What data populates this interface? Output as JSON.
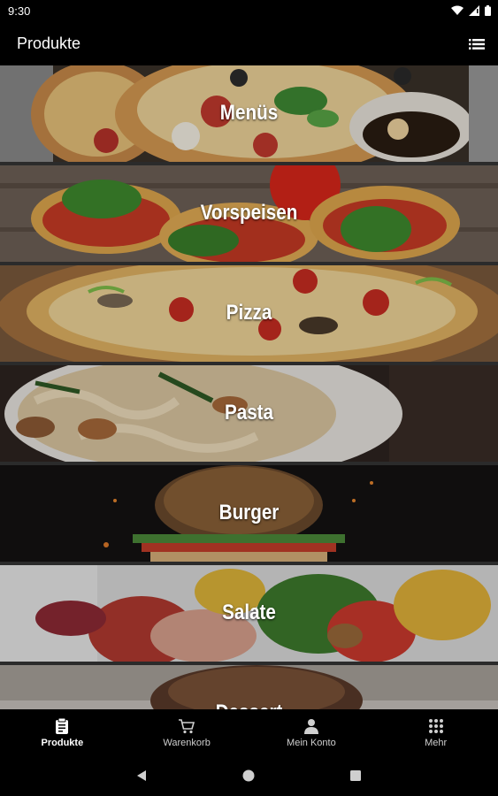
{
  "status_bar": {
    "time": "9:30"
  },
  "app_bar": {
    "title": "Produkte",
    "list_icon": "list-view-icon"
  },
  "categories": [
    {
      "label": "Menüs",
      "image": "menu-food-photo"
    },
    {
      "label": "Vorspeisen",
      "image": "bruschetta-photo"
    },
    {
      "label": "Pizza",
      "image": "pizza-photo"
    },
    {
      "label": "Pasta",
      "image": "pasta-photo"
    },
    {
      "label": "Burger",
      "image": "burger-photo"
    },
    {
      "label": "Salate",
      "image": "salad-photo"
    },
    {
      "label": "Dessert",
      "image": "dessert-photo"
    }
  ],
  "bottom_nav": [
    {
      "label": "Produkte",
      "icon": "clipboard-icon",
      "active": true
    },
    {
      "label": "Warenkorb",
      "icon": "cart-icon",
      "active": false
    },
    {
      "label": "Mein Konto",
      "icon": "person-icon",
      "active": false
    },
    {
      "label": "Mehr",
      "icon": "grid-icon",
      "active": false
    }
  ],
  "colors": {
    "background": "#000000",
    "text": "#ffffff",
    "inactive_text": "#cfcfcf"
  }
}
